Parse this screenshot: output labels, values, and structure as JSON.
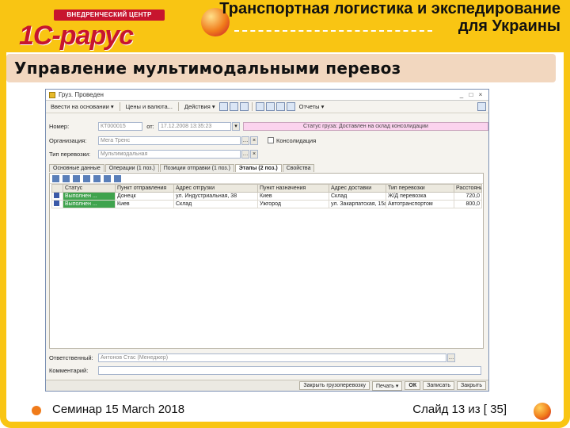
{
  "slide": {
    "title_line1": "Транспортная логистика и экспедирование",
    "title_line2": "для Украины",
    "subtitle": "Управление мультимодальными перевоз",
    "logo_top": "ВНЕДРЕНЧЕСКИЙ ЦЕНТР",
    "logo_main": "1С-рарус",
    "footer_left": "Семинар 15 March 2018",
    "footer_right": "Слайд 13 из [ 35]",
    "colors": {
      "frame": "#f9c513",
      "accent": "#c7152e",
      "subtitle_band": "#f2d7bf"
    }
  },
  "window": {
    "title": "Груз. Проведен",
    "controls": [
      "_",
      "□",
      "×"
    ],
    "toolbar": {
      "ops": "Ввести на основании ▾",
      "prices": "Цены и валюта...",
      "actions": "Действия ▾",
      "reports": "Отчеты ▾"
    },
    "fields": {
      "number_label": "Номер:",
      "number_value": "КТ000015",
      "date_sep": "от:",
      "date_value": "17.12.2008 13:35:23",
      "status_value": "Статус груза: Доставлен на склад консолидации",
      "org_label": "Организация:",
      "org_value": "Мега Тренс",
      "consol_label": "Консолидация",
      "ship_type_label": "Тип перевозки:",
      "ship_type_value": "Мультимодальная"
    },
    "tabs": [
      "Основные данные",
      "Операции (1 поз.)",
      "Позиции отправки (1 поз.)",
      "Этапы (2 поз.)",
      "Свойства"
    ],
    "grid": {
      "columns": [
        "Статус",
        "Пункт отправления",
        "Адрес отгрузки",
        "Пункт назначения",
        "Адрес доставки",
        "Тип перевозки",
        "Расстояние"
      ],
      "rows": [
        [
          "Выполнен ...",
          "Донецк",
          "ул. Индустриальная, 38",
          "Киев",
          "Склад",
          "Ж/Д перевозка",
          "720,0"
        ],
        [
          "Выполнен ...",
          "Киев",
          "Склад",
          "Ужгород",
          "ул. Закарпатская, 15а",
          "Автотранспортом",
          "800,0"
        ]
      ]
    },
    "responsible_label": "Ответственный:",
    "responsible_value": "Антонов Стас (Менеджер)",
    "comment_label": "Комментарий:",
    "buttons": {
      "close_doc": "Закрыть грузоперевозку",
      "print": "Печать ▾",
      "ok": "ОК",
      "save": "Записать",
      "close": "Закрыть"
    }
  }
}
